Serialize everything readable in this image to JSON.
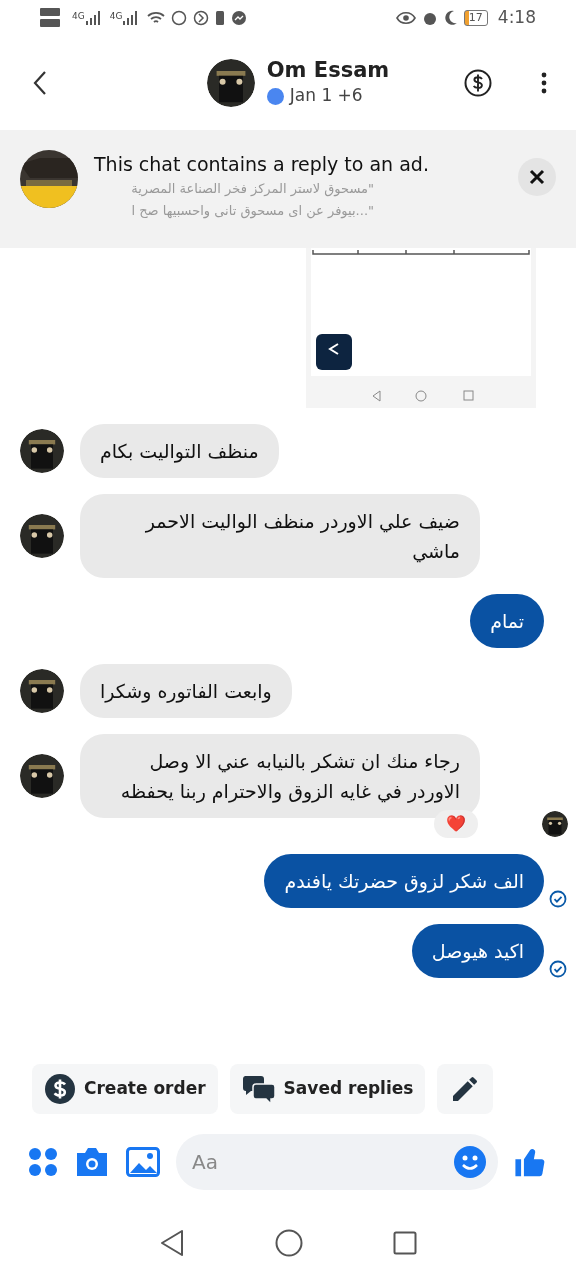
{
  "status_bar": {
    "sim1_network": "4G",
    "sim2_network": "4G",
    "battery": "17",
    "time": "4:18"
  },
  "header": {
    "name": "Om Essam",
    "online": true,
    "subtitle": "Jan 1 +6"
  },
  "ad_banner": {
    "title": "This chat contains a reply to an ad.",
    "quote_lines": [
      "\"مسحوق لاستر المركز فخر الصناعة المصرية",
      "\"...بيوفر عن اى مسحوق تانى واحسبيها صح ا"
    ]
  },
  "messages": [
    {
      "kind": "incoming",
      "text": "منظف التواليت بكام"
    },
    {
      "kind": "incoming",
      "text": "ضيف علي الاوردر منظف الواليت الاحمر ماشي"
    },
    {
      "kind": "outgoing",
      "text": "تمام",
      "delivered": false
    },
    {
      "kind": "incoming",
      "text": "وابعت الفاتوره وشكرا"
    },
    {
      "kind": "incoming",
      "text": "رجاء منك ان تشكر بالنيابه عني الا وصل الاوردر في غايه الزوق والاحترام ربنا يحفظه",
      "reaction": "❤️",
      "seen_here": true
    },
    {
      "kind": "outgoing",
      "text": "الف شكر لزوق حضرتك يافندم",
      "delivered": true
    },
    {
      "kind": "outgoing",
      "text": "اكيد هيوصل",
      "delivered": true
    }
  ],
  "quick_actions": {
    "create_order": "Create order",
    "saved_replies": "Saved replies"
  },
  "composer": {
    "placeholder": "Aa"
  }
}
